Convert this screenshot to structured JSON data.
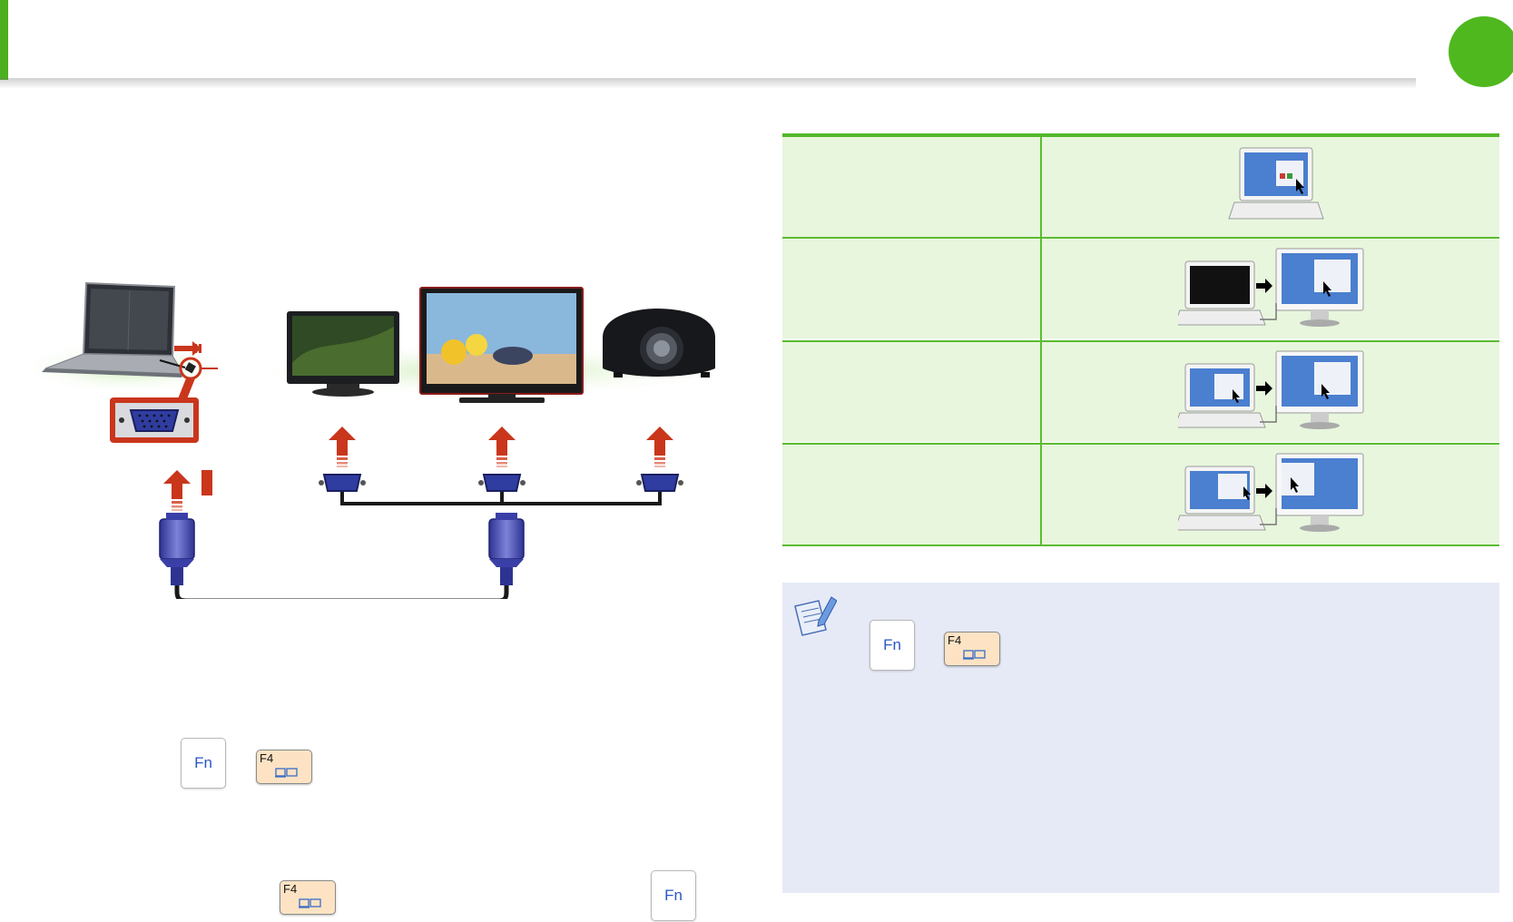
{
  "page": {
    "colors": {
      "accent_green": "#4fb81f",
      "note_bg": "#e6eaf7",
      "table_bg": "#e8f6dd",
      "arrow_red": "#c9361c",
      "connector_blue": "#3a3fa8"
    }
  },
  "keys": {
    "fn_label": "Fn",
    "f4_label": "F4"
  },
  "display_modes": {
    "rows": [
      {
        "label": "",
        "icon": "laptop-only-display"
      },
      {
        "label": "",
        "icon": "external-monitor-only-display"
      },
      {
        "label": "",
        "icon": "clone-display"
      },
      {
        "label": "",
        "icon": "extended-display"
      }
    ]
  },
  "note": {
    "icon": "note-pencil-icon"
  },
  "diagram": {
    "devices": [
      "laptop-icon",
      "monitor-icon",
      "tv-icon",
      "projector-icon"
    ]
  }
}
